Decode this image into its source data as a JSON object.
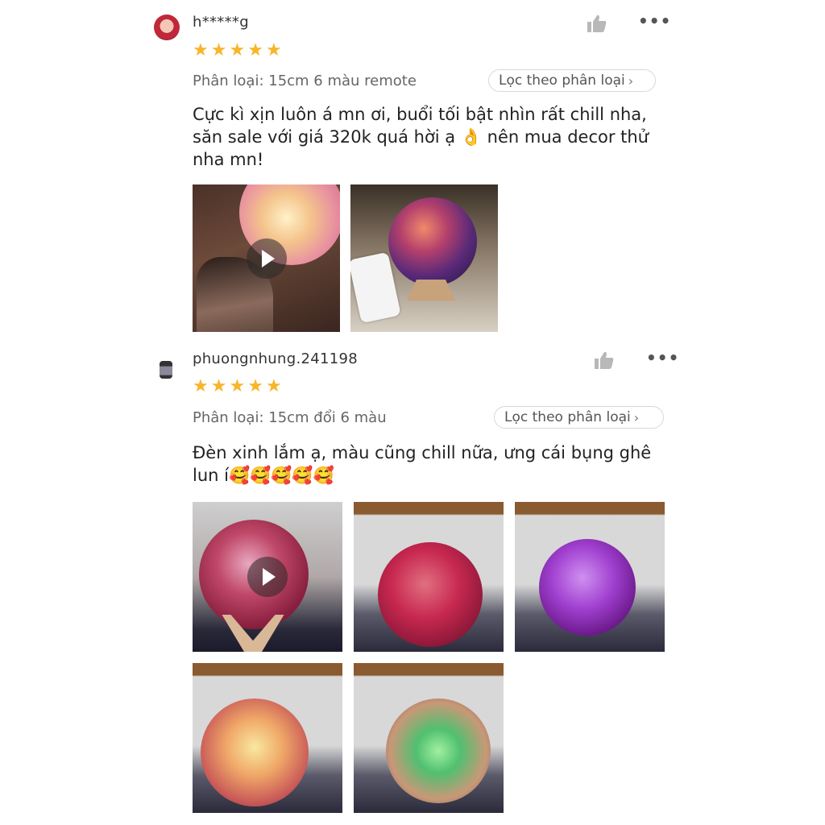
{
  "reviews": [
    {
      "username": "h*****g",
      "rating": 5,
      "variant": "Phân loại: 15cm 6 màu remote",
      "filter_label": "Lọc theo phân loại",
      "comment": "Cực kì xịn luôn á mn ơi, buổi tối bật nhìn rất chill nha, săn sale với giá 320k quá hời ạ 👌 nên mua decor thử nha mn!"
    },
    {
      "username": "phuongnhung.241198",
      "rating": 5,
      "variant": "Phân loại: 15cm đổi 6 màu",
      "filter_label": "Lọc theo phân loại",
      "comment": "Đèn xinh lắm ạ, màu cũng chill nữa, ưng cái bụng ghê lun í🥰🥰🥰🥰🥰"
    }
  ],
  "icons": {
    "like": "thumbs-up-icon",
    "more": "more-options-icon",
    "star": "star-icon",
    "play": "play-icon",
    "chevron": "chevron-right-icon"
  },
  "colors": {
    "star": "#f7b529",
    "muted": "#666666",
    "border": "#d8d8d8"
  }
}
